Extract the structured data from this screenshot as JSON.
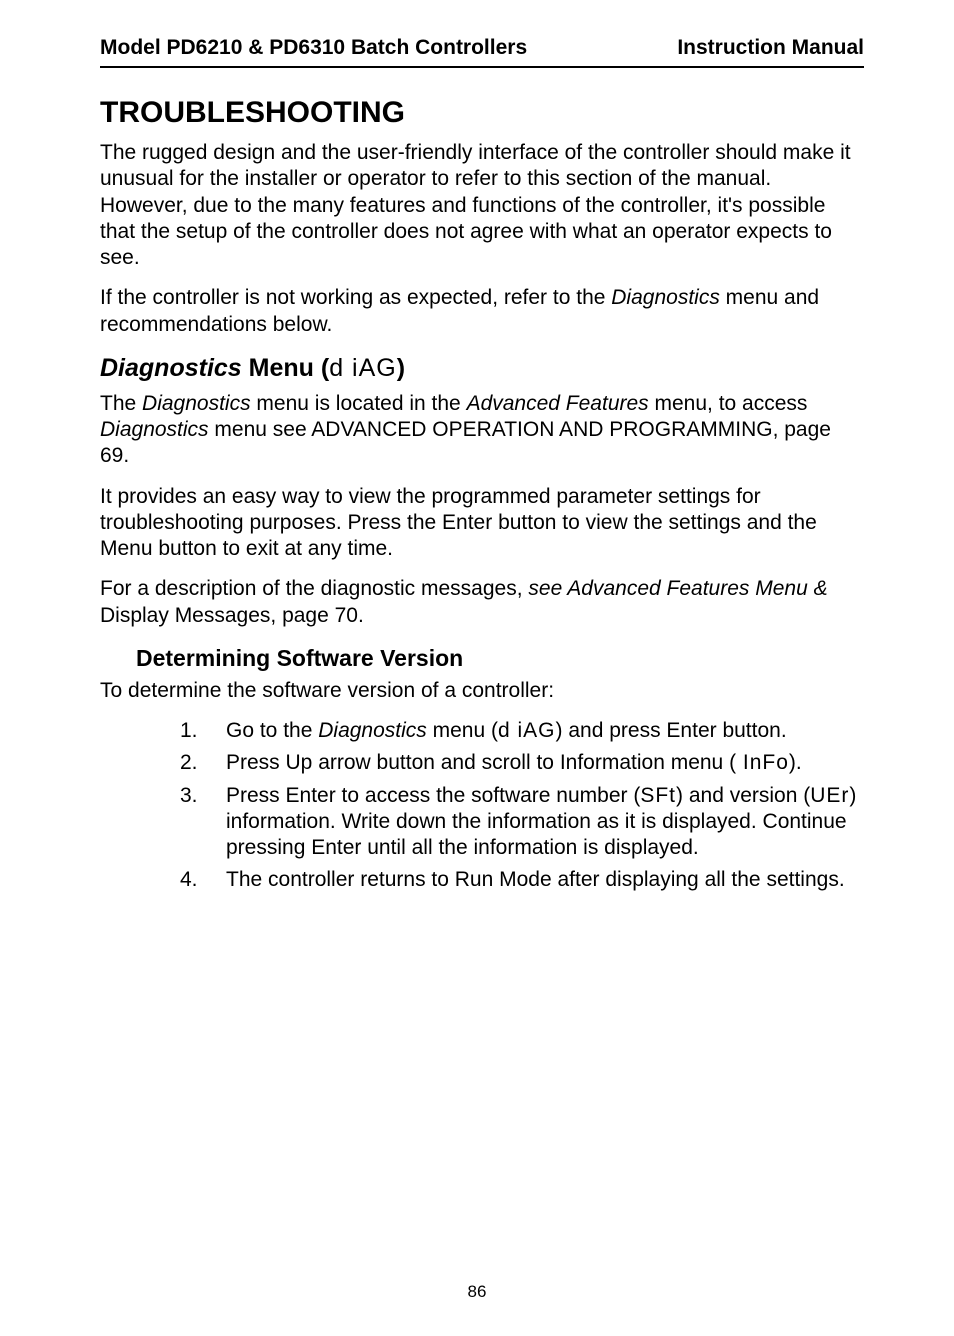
{
  "header": {
    "left": "Model PD6210 & PD6310 Batch Controllers",
    "right": "Instruction Manual"
  },
  "h1": "TROUBLESHOOTING",
  "para1": "The rugged design and the user-friendly interface of the controller should make it unusual for the installer or operator to refer to this section of the manual. However, due to the many features and functions of the controller, it's possible that the setup of the controller does not agree with what an operator expects to see.",
  "para2_pre": "If the controller is not working as expected, refer to the ",
  "para2_em": "Diagnostics",
  "para2_post": " menu and recommendations below.",
  "h2_em": "Diagnostics",
  "h2_plain": " Menu (",
  "h2_seg": "d iAG",
  "h2_close": ")",
  "para3_a": "The ",
  "para3_b": "Diagnostics",
  "para3_c": " menu is located in the ",
  "para3_d": "Advanced Features",
  "para3_e": " menu, to access ",
  "para3_f": "Diagnostics",
  "para3_g": " menu see ADVANCED OPERATION AND PROGRAMMING, page 69.",
  "para4": "It provides an easy way to view the programmed parameter settings for troubleshooting purposes. Press the Enter button to view the settings and the Menu button to exit at any time.",
  "para5_a": "For a description of the diagnostic messages, ",
  "para5_b": "see Advanced Features Menu &",
  "para5_c": " Display Messages, page 70.",
  "h3": "Determining Software Version",
  "para6": "To determine the software version of a controller:",
  "list": {
    "n1": "1.",
    "li1_a": "Go to the ",
    "li1_b": "Diagnostics",
    "li1_c": " menu (",
    "li1_seg": "d iAG",
    "li1_d": ") and press Enter button.",
    "n2": "2.",
    "li2_a": "Press Up arrow button and scroll to Information menu (",
    "li2_seg": " InFo",
    "li2_b": ").",
    "n3": "3.",
    "li3_a": "Press Enter to access the software number (",
    "li3_seg1": "SFt",
    "li3_b": ") and version (",
    "li3_seg2": "UEr",
    "li3_c": ") information. Write down the information as it is displayed. Continue pressing Enter until all the information is displayed.",
    "n4": "4.",
    "li4": "The controller returns to Run Mode after displaying all the settings."
  },
  "page_number": "86"
}
